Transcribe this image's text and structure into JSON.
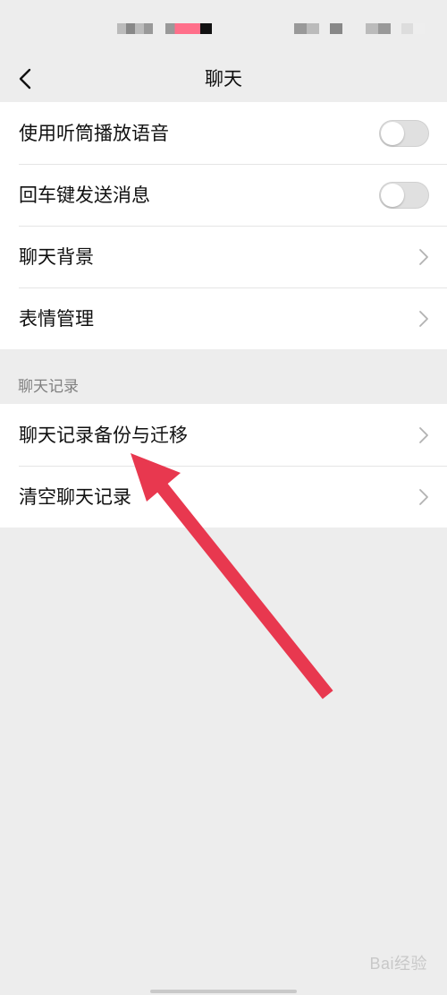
{
  "nav": {
    "title": "聊天"
  },
  "settings_group_1": {
    "items": [
      {
        "label": "使用听筒播放语音",
        "control": "toggle",
        "on": false
      },
      {
        "label": "回车键发送消息",
        "control": "toggle",
        "on": false
      },
      {
        "label": "聊天背景",
        "control": "chevron"
      },
      {
        "label": "表情管理",
        "control": "chevron"
      }
    ]
  },
  "section": {
    "header": "聊天记录"
  },
  "settings_group_2": {
    "items": [
      {
        "label": "聊天记录备份与迁移",
        "control": "chevron"
      },
      {
        "label": "清空聊天记录",
        "control": "chevron"
      }
    ]
  },
  "annotation": {
    "arrow_color": "#e8384f"
  },
  "watermark": {
    "text": "Bai经验"
  },
  "colors": {
    "background": "#ededed",
    "card": "#ffffff",
    "toggle_off": "#e0e0e0"
  },
  "icons": {
    "back": "chevron-left-icon",
    "row_arrow": "chevron-right-icon"
  }
}
